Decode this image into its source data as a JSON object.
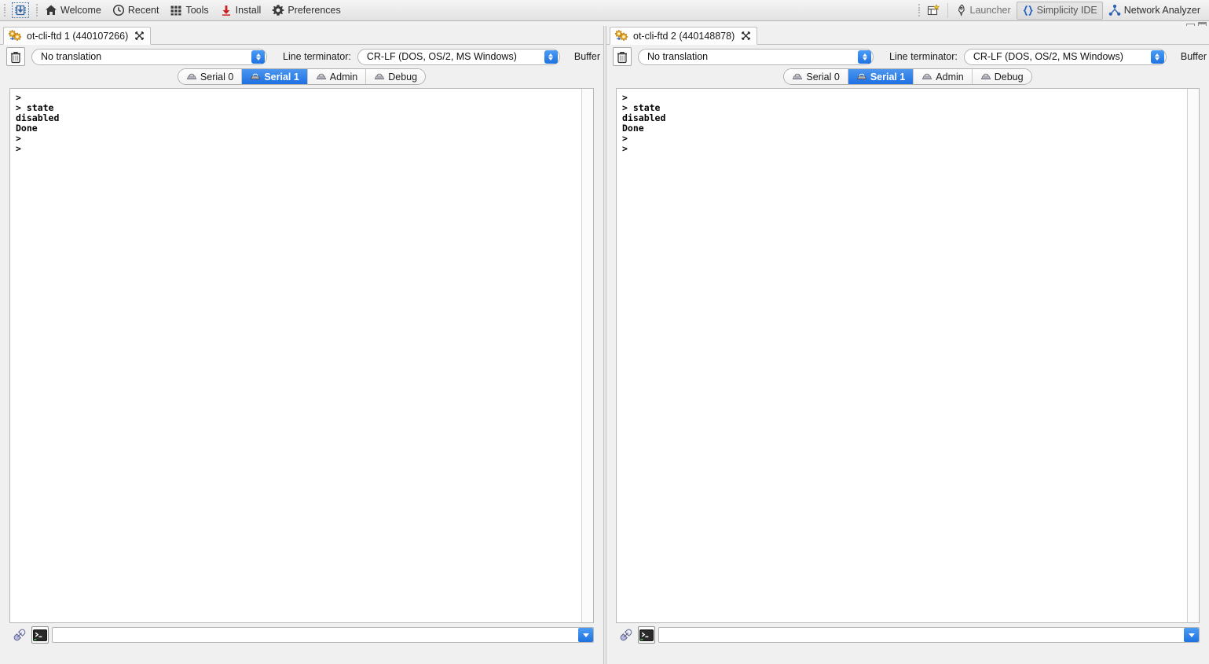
{
  "toolbar": {
    "left_items": [
      {
        "name": "debug-chip-icon",
        "label": "",
        "icon": "chip-download-icon"
      },
      {
        "name": "welcome",
        "label": "Welcome",
        "icon": "home-icon"
      },
      {
        "name": "recent",
        "label": "Recent",
        "icon": "clock-icon"
      },
      {
        "name": "tools",
        "label": "Tools",
        "icon": "grid-icon"
      },
      {
        "name": "install",
        "label": "Install",
        "icon": "download-icon"
      },
      {
        "name": "preferences",
        "label": "Preferences",
        "icon": "gear-icon"
      }
    ],
    "right_items": [
      {
        "name": "open-perspective",
        "label": "",
        "icon": "new-perspective-icon"
      },
      {
        "name": "launcher",
        "label": "Launcher",
        "icon": "rocket-icon"
      },
      {
        "name": "simplicity-ide",
        "label": "Simplicity IDE",
        "icon": "braces-icon",
        "selected": true
      },
      {
        "name": "network-analyzer",
        "label": "Network Analyzer",
        "icon": "network-icon"
      }
    ],
    "accent_blue": "#1f72e0",
    "selected_bg": "#e2e2e2"
  },
  "panels": [
    {
      "tab_title": "ot-cli-ftd 1 (440107266)",
      "translation": {
        "value": "No translation",
        "label": ""
      },
      "line_terminator": {
        "label": "Line terminator:",
        "value": "CR-LF  (DOS, OS/2, MS Windows)"
      },
      "buffer_size_label": "Buffer size",
      "serial_tabs": [
        {
          "label": "Serial 0",
          "active": false
        },
        {
          "label": "Serial 1",
          "active": true
        },
        {
          "label": "Admin",
          "active": false
        },
        {
          "label": "Debug",
          "active": false
        }
      ],
      "terminal_text": ">\n> state\ndisabled\nDone\n>\n>",
      "input_value": "",
      "input_placeholder": ""
    },
    {
      "tab_title": "ot-cli-ftd 2 (440148878)",
      "translation": {
        "value": "No translation",
        "label": ""
      },
      "line_terminator": {
        "label": "Line terminator:",
        "value": "CR-LF  (DOS, OS/2, MS Windows)"
      },
      "buffer_size_label": "Buffer size",
      "serial_tabs": [
        {
          "label": "Serial 0",
          "active": false
        },
        {
          "label": "Serial 1",
          "active": true
        },
        {
          "label": "Admin",
          "active": false
        },
        {
          "label": "Debug",
          "active": false
        }
      ],
      "terminal_text": ">\n> state\ndisabled\nDone\n>\n>",
      "input_value": "",
      "input_placeholder": ""
    }
  ]
}
